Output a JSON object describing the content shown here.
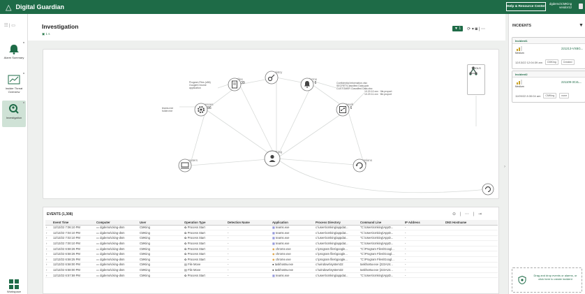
{
  "topbar": {
    "logo_glyph": "△",
    "app_name": "Digital Guardian",
    "help_label": "Help & Resource Center",
    "user_name": "dgdemo\\CMKing",
    "user_sub": "vendor12",
    "brand_color": "#1e6b47"
  },
  "nav": {
    "toggle_glyphs": "☷ | ▭",
    "items": [
      {
        "label": "Alarm Summary",
        "icon": "bell-icon"
      },
      {
        "label": "Insider Threat Overview",
        "icon": "chart-icon"
      },
      {
        "label": "Investigation",
        "icon": "investigation-icon"
      }
    ],
    "footer_label": "Workspace"
  },
  "header": {
    "title": "Investigation",
    "subtitle": "▣ 1 s",
    "filter_badge": "▼ 1",
    "icons": "⟳ ▾  ◙  |  ⋯"
  },
  "graph": {
    "center": {
      "label": "CMKing"
    },
    "nodes": [
      {
        "id": "computers",
        "label": "Computers",
        "count": "1",
        "icon": "laptop-icon"
      },
      {
        "id": "processes",
        "label": "Processes",
        "count": "2 of 56",
        "icon": "gear-icon"
      },
      {
        "id": "files",
        "label": "Files",
        "count": "4 of 39",
        "icon": "file-icon"
      },
      {
        "id": "registry",
        "label": "Registry",
        "count": "0",
        "icon": "key-icon"
      },
      {
        "id": "alarms",
        "label": "Alarms",
        "count": "3 of 6",
        "icon": "alarm-icon"
      },
      {
        "id": "network",
        "label": "Network",
        "count": "2 of 6",
        "icon": "network-icon"
      },
      {
        "id": "operations",
        "label": "Operations",
        "count": "13",
        "icon": "refresh-icon"
      }
    ],
    "callouts": [
      "Program Files (x86)\nGoogle\\Chrome\napplication",
      "teams.exe\nfolder.exe",
      "Confidential Information.xlsx\nSECRET\\Classified Data.pptx\nCUSTOMER Classified Data.xlsx",
      "10.20.10.xxx · file.proport\n10.20.11.xxx · file.proport"
    ],
    "tools_label": "TOOLS"
  },
  "events": {
    "title": "EVENTS (1,308)",
    "columns": [
      "",
      "Event Time",
      "",
      "Computer",
      "User",
      "Operation Type",
      "Detection Name",
      "Application",
      "Process Directory",
      "Command Line",
      "IP Address",
      "DNS Hostname"
    ],
    "rows": [
      [
        "›",
        "12/13/22 7:06:10 PM",
        "",
        "dgdemo\\cking-dsm",
        "CMKing",
        "Process Start",
        "-",
        "teams.exe",
        "c:\\users\\cmking\\appdat...",
        "\"C:\\Users\\cmking\\AppD...",
        "-",
        ""
      ],
      [
        "›",
        "12/13/22 7:04:10 PM",
        "",
        "dgdemo\\cking-dsm",
        "CMKing",
        "Process Start",
        "-",
        "teams.exe",
        "c:\\users\\cmking\\appdat...",
        "\"C:\\Users\\cmking\\AppD...",
        "-",
        ""
      ],
      [
        "›",
        "12/13/22 7:02:10 PM",
        "",
        "dgdemo\\cking-dsm",
        "CMKing",
        "Process Start",
        "-",
        "teams.exe",
        "c:\\users\\cmking\\appdat...",
        "\"C:\\Users\\cmking\\AppD...",
        "-",
        ""
      ],
      [
        "›",
        "12/13/22 7:00:10 PM",
        "",
        "dgdemo\\cking-dsm",
        "CMKing",
        "Process Start",
        "-",
        "teams.exe",
        "c:\\users\\cmking\\appdat...",
        "\"C:\\Users\\cmking\\AppD...",
        "-",
        ""
      ],
      [
        "›",
        "12/13/22 6:58:26 PM",
        "",
        "dgdemo\\cking-dsm",
        "CMKing",
        "Process Start",
        "-",
        "chrome.exe",
        "c:\\program files\\google...",
        "\"C:\\Program Files\\Googl...",
        "-",
        ""
      ],
      [
        "›",
        "12/13/22 6:58:26 PM",
        "",
        "dgdemo\\cking-dsm",
        "CMKing",
        "Process Start",
        "-",
        "chrome.exe",
        "c:\\program files\\google...",
        "\"C:\\Program Files\\Googl...",
        "-",
        ""
      ],
      [
        "›",
        "12/13/22 6:58:25 PM",
        "",
        "dgdemo\\cking-dsm",
        "CMKing",
        "Process Start",
        "-",
        "chrome.exe",
        "c:\\program files\\google...",
        "\"C:\\Program Files\\Googl...",
        "-",
        ""
      ],
      [
        "›",
        "12/13/22 6:58:00 PM",
        "",
        "dgdemo\\cking-dsm",
        "CMKing",
        "File Move",
        "-",
        "taskhostw.exe",
        "c:\\windows\\system32",
        "taskhostw.exe {222A24...",
        "-",
        ""
      ],
      [
        "›",
        "12/13/22 6:58:00 PM",
        "",
        "dgdemo\\cking-dsm",
        "CMKing",
        "File Move",
        "-",
        "taskhostw.exe",
        "c:\\windows\\system32",
        "taskhostw.exe {222A24...",
        "-",
        ""
      ],
      [
        "›",
        "12/13/22 6:57:59 PM",
        "",
        "dgdemo\\cking-dsm",
        "CMKing",
        "Process Start",
        "-",
        "teams.exe",
        "c:\\users\\cmking\\appdat...",
        "\"C:\\Users\\cmking\\AppD...",
        "-",
        ""
      ]
    ],
    "row_icons": [
      "monitor-icon",
      "gear-icon",
      "teams-icon"
    ],
    "top_icons": "⊖ | ⋯ | ⇥"
  },
  "incidents": {
    "title": "INCIDENTS",
    "cards": [
      {
        "name": "Incident1",
        "severity": "Medium",
        "id": "221213-VXBG...",
        "time": "12/13/22 12:04:39 am",
        "owner": "CMKing",
        "status": "Created"
      },
      {
        "name": "Incident2",
        "severity": "Medium",
        "id": "221109-3C4L...",
        "time": "11/09/22 8:30:04 am",
        "owner": "CMKing",
        "status": "none"
      }
    ],
    "dropzone": "Drag and drop events or alarms, or click here to create incident"
  }
}
